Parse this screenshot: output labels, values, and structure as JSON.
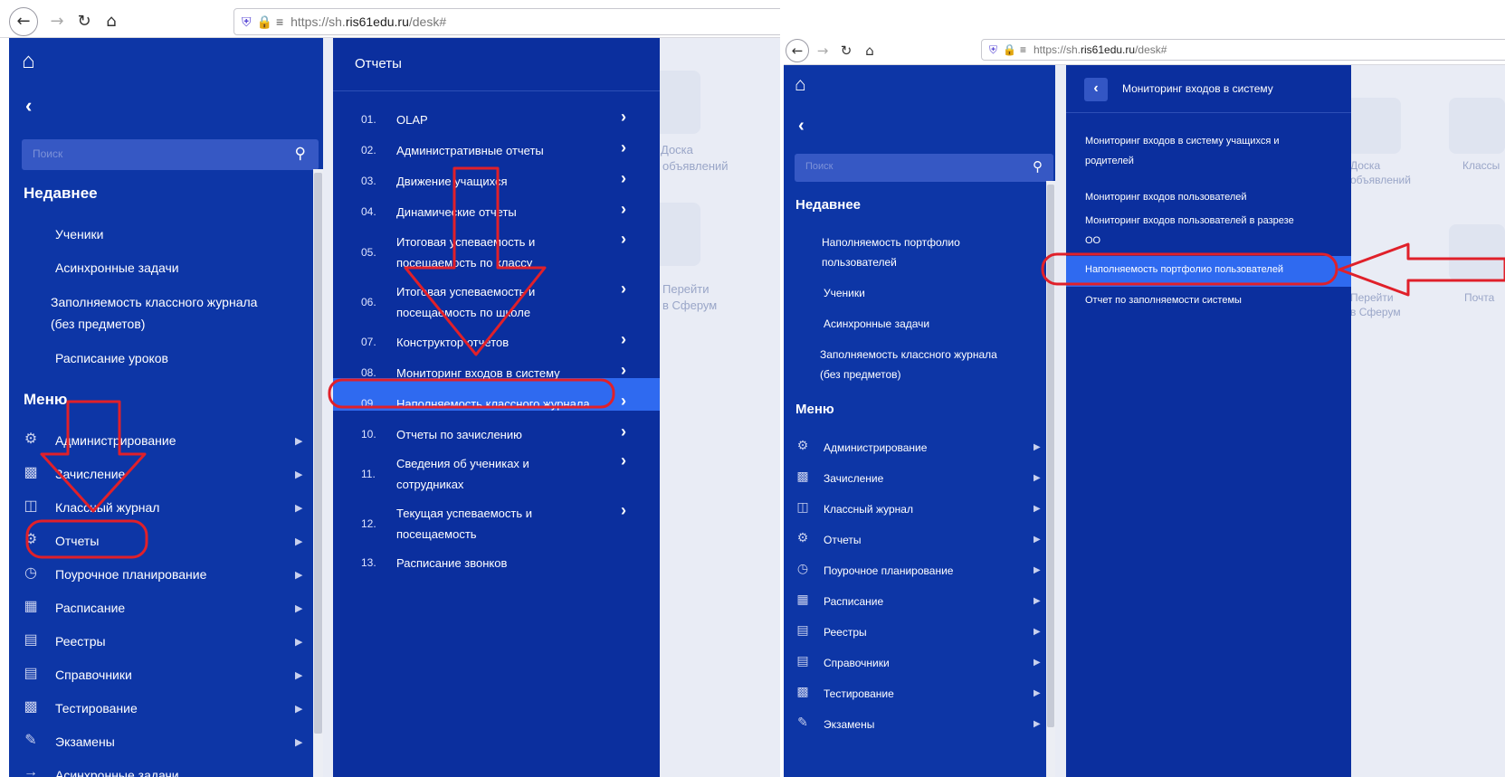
{
  "browser": {
    "url_host_prefix": "https://sh.",
    "url_host": "ris61edu.ru",
    "url_path": "/desk#",
    "icons": [
      "back-arrow-icon",
      "forward-arrow-icon",
      "reload-icon",
      "home-icon",
      "shield-icon",
      "lock-icon",
      "permissions-icon"
    ]
  },
  "colors": {
    "sidebar": "#0d36a6",
    "submenu": "#0b2f9e",
    "highlight": "#2f6af0",
    "annotation": "#e0202a"
  },
  "left_shot": {
    "search_placeholder": "Поиск",
    "recent_heading": "Недавнее",
    "recent": [
      "Ученики",
      "Асинхронные задачи",
      "Заполняемость классного журнала",
      "(без предметов)",
      "Расписание уроков"
    ],
    "menu_heading": "Меню",
    "menu": [
      "Администрирование",
      "Зачисление",
      "Классный журнал",
      "Отчеты",
      "Поурочное планирование",
      "Расписание",
      "Реестры",
      "Справочники",
      "Тестирование",
      "Экзамены",
      "Асинхронные задачи"
    ],
    "submenu_title": "Отчеты",
    "submenu": [
      {
        "num": "01.",
        "lines": [
          "OLAP"
        ],
        "arrow": true
      },
      {
        "num": "02.",
        "lines": [
          "Административные отчеты"
        ],
        "arrow": true
      },
      {
        "num": "03.",
        "lines": [
          "Движение учащихся"
        ],
        "arrow": true
      },
      {
        "num": "04.",
        "lines": [
          "Динамические отчеты"
        ],
        "arrow": true
      },
      {
        "num": "05.",
        "lines": [
          "Итоговая успеваемость и",
          "посещаемость по классу"
        ],
        "arrow": true
      },
      {
        "num": "06.",
        "lines": [
          "Итоговая успеваемость и",
          "посещаемость по школе"
        ],
        "arrow": true
      },
      {
        "num": "07.",
        "lines": [
          "Конструктор отчетов"
        ],
        "arrow": true
      },
      {
        "num": "08.",
        "lines": [
          "Мониторинг входов в систему"
        ],
        "arrow": true,
        "selected": true
      },
      {
        "num": "09.",
        "lines": [
          "Наполняемость классного журнала"
        ],
        "arrow": true
      },
      {
        "num": "10.",
        "lines": [
          "Отчеты по зачислению"
        ],
        "arrow": true
      },
      {
        "num": "11.",
        "lines": [
          "Сведения об учениках и",
          "сотрудниках"
        ],
        "arrow": true
      },
      {
        "num": "12.",
        "lines": [
          "Текущая успеваемость и",
          "посещаемость"
        ],
        "arrow": true
      },
      {
        "num": "13.",
        "lines": [
          "Расписание звонков"
        ],
        "arrow": false
      }
    ],
    "background_tiles": [
      "Доска",
      "объявлений",
      "Перейти",
      "в Сферум"
    ]
  },
  "right_shot": {
    "search_placeholder": "Поиск",
    "recent_heading": "Недавнее",
    "recent": [
      "Наполняемость портфолио",
      "пользователей",
      "Ученики",
      "Асинхронные задачи",
      "Заполняемость классного журнала",
      "(без предметов)"
    ],
    "menu_heading": "Меню",
    "menu": [
      "Администрирование",
      "Зачисление",
      "Классный журнал",
      "Отчеты",
      "Поурочное планирование",
      "Расписание",
      "Реестры",
      "Справочники",
      "Тестирование",
      "Экзамены"
    ],
    "submenu_title": "Мониторинг входов в систему",
    "submenu": [
      {
        "lines": [
          "Мониторинг входов в систему учащихся и",
          "родителей"
        ]
      },
      {
        "lines": [
          "Мониторинг входов пользователей"
        ]
      },
      {
        "lines": [
          "Мониторинг входов пользователей в разрезе",
          "ОО"
        ]
      },
      {
        "lines": [
          "Наполняемость портфолио пользователей"
        ],
        "selected": true
      },
      {
        "lines": [
          "Отчет по заполняемости системы"
        ]
      }
    ],
    "background_tiles": [
      "Доска",
      "объявлений",
      "Классы",
      "Перейти",
      "в Сферум",
      "Почта"
    ]
  }
}
